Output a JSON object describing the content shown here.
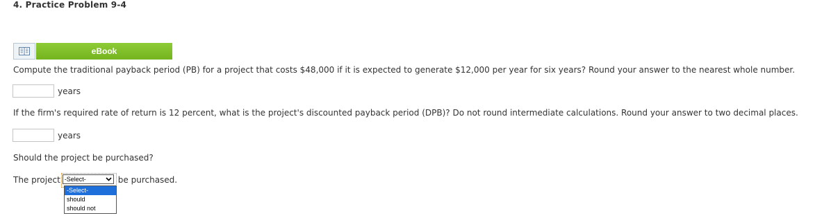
{
  "problem": {
    "title": "4.  Practice Problem 9-4"
  },
  "ebook": {
    "icon": "book-icon",
    "label": "eBook",
    "color": "#7cbd27"
  },
  "questions": {
    "q1": "Compute the traditional payback period (PB) for a project that costs $48,000 if it is expected to generate $12,000 per year for six years? Round your answer to the nearest whole number.",
    "q1_input_value": "",
    "q1_unit": "years",
    "q2": "If the firm's required rate of return is 12 percent, what is the project's discounted payback period (DPB)? Do not round intermediate calculations. Round your answer to two decimal places.",
    "q2_input_value": "",
    "q2_unit": "years",
    "q3": "Should the project be purchased?",
    "q3_prefix": "The project",
    "q3_suffix": "be purchased."
  },
  "select": {
    "value": "-Select-",
    "options": [
      "-Select-",
      "should",
      "should not"
    ],
    "highlight_color": "#1e6fd9",
    "focus_color": "#e07b00"
  }
}
